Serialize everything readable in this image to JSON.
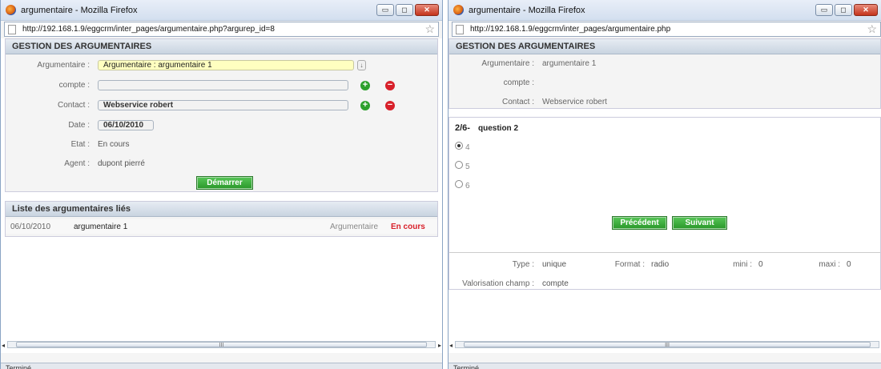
{
  "left": {
    "window_title": "argumentaire - Mozilla Firefox",
    "url": "http://192.168.1.9/eggcrm/inter_pages/argumentaire.php?argurep_id=8",
    "section_title": "GESTION DES ARGUMENTAIRES",
    "fields": {
      "argumentaire_label": "Argumentaire :",
      "argumentaire_value": "Argumentaire : argumentaire 1",
      "compte_label": "compte :",
      "compte_value": "",
      "contact_label": "Contact :",
      "contact_value": "Webservice robert",
      "date_label": "Date :",
      "date_value": "06/10/2010",
      "etat_label": "Etat :",
      "etat_value": "En cours",
      "agent_label": "Agent :",
      "agent_value": "dupont pierré"
    },
    "start_button": "Démarrer",
    "linked_title": "Liste des argumentaires liés",
    "linked_rows": [
      {
        "date": "06/10/2010",
        "name": "argumentaire 1",
        "type": "Argumentaire",
        "status": "En cours"
      }
    ],
    "status_text": "Terminé"
  },
  "right": {
    "window_title": "argumentaire - Mozilla Firefox",
    "url": "http://192.168.1.9/eggcrm/inter_pages/argumentaire.php",
    "section_title": "GESTION DES ARGUMENTAIRES",
    "fields": {
      "argumentaire_label": "Argumentaire :",
      "argumentaire_value": "argumentaire 1",
      "compte_label": "compte :",
      "compte_value": "",
      "contact_label": "Contact :",
      "contact_value": "Webservice robert"
    },
    "question_number": "2/6-",
    "question_text": "question 2",
    "options": [
      "4",
      "5",
      "6"
    ],
    "selected_option": "4",
    "prev_button": "Précédent",
    "next_button": "Suivant",
    "meta": {
      "type_label": "Type :",
      "type_value": "unique",
      "format_label": "Format :",
      "format_value": "radio",
      "mini_label": "mini :",
      "mini_value": "0",
      "maxi_label": "maxi :",
      "maxi_value": "0",
      "valorisation_label": "Valorisation champ :",
      "valorisation_value": "compte"
    },
    "status_text": "Terminé"
  },
  "window_buttons": {
    "minimize": "▭",
    "maximize": "◻",
    "close": "✕"
  },
  "colors": {
    "accent_green": "#2c9a2c",
    "status_red": "#d8202a",
    "highlight_yellow": "#ffffc0"
  }
}
